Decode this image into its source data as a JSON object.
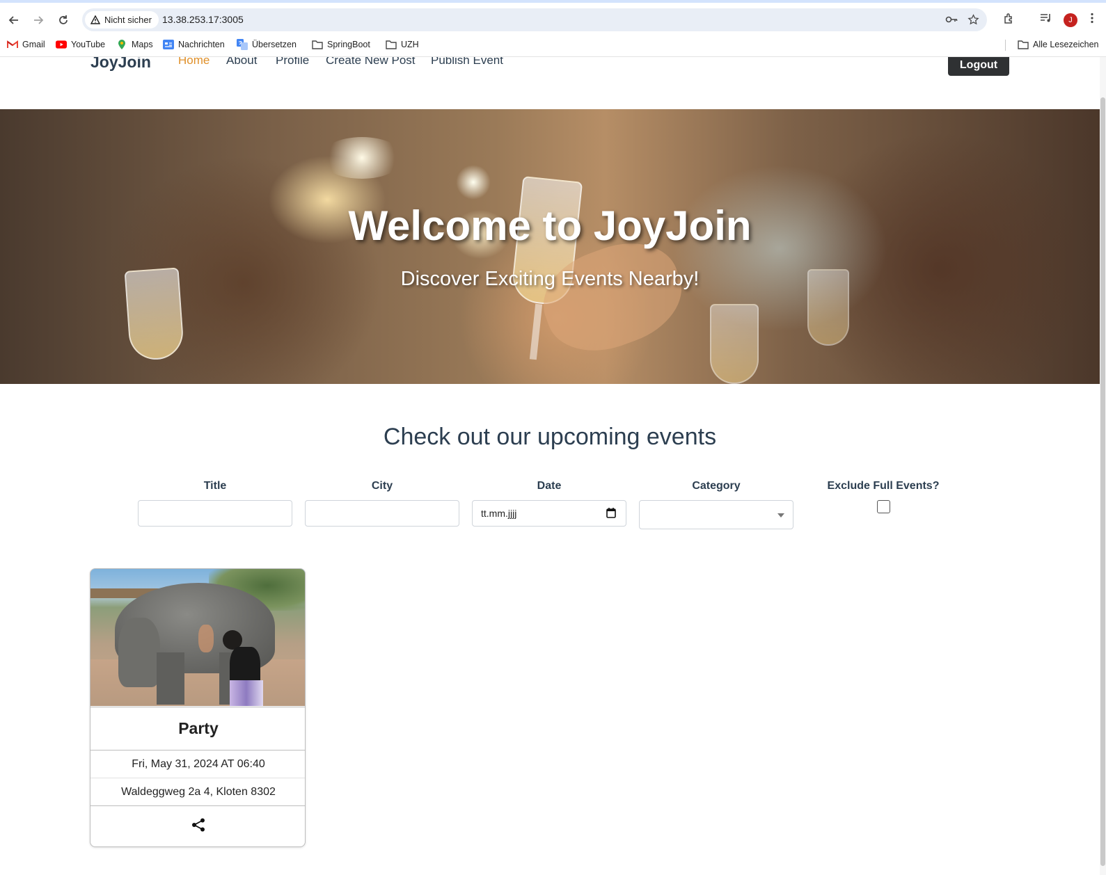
{
  "browser": {
    "security_label": "Nicht sicher",
    "url": "13.38.253.17:3005",
    "avatar_letter": "J",
    "bookmarks": [
      {
        "label": "Gmail",
        "icon": "gmail-icon"
      },
      {
        "label": "YouTube",
        "icon": "youtube-icon"
      },
      {
        "label": "Maps",
        "icon": "maps-icon"
      },
      {
        "label": "Nachrichten",
        "icon": "news-icon"
      },
      {
        "label": "Übersetzen",
        "icon": "translate-icon"
      },
      {
        "label": "SpringBoot",
        "icon": "folder-icon"
      },
      {
        "label": "UZH",
        "icon": "folder-icon"
      }
    ],
    "all_bookmarks": "Alle Lesezeichen"
  },
  "nav": {
    "brand": "JoyJoin",
    "links": [
      "Home",
      "About",
      "Profile",
      "Create New Post",
      "Publish Event"
    ],
    "active": "Home",
    "logout": "Logout"
  },
  "hero": {
    "title": "Welcome to JoyJoin",
    "subtitle": "Discover Exciting Events Nearby!"
  },
  "events_section": {
    "title": "Check out our upcoming events",
    "filters": {
      "title_label": "Title",
      "city_label": "City",
      "date_label": "Date",
      "date_placeholder": "tt.mm.jjjj",
      "category_label": "Category",
      "exclude_full_label": "Exclude Full Events?"
    }
  },
  "events": [
    {
      "title": "Party",
      "datetime": "Fri, May 31, 2024 AT 06:40",
      "address": "Waldeggweg 2a 4, Kloten 8302"
    }
  ],
  "colors": {
    "accent": "#e0902a",
    "text": "#2c3e50",
    "logout_bg": "#2f3133"
  }
}
